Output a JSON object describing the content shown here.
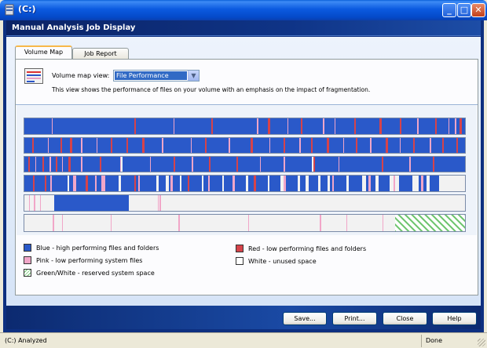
{
  "window": {
    "title": "(C:)"
  },
  "header": {
    "title": "Manual Analysis Job Display"
  },
  "tabs": [
    {
      "label": "Volume Map"
    },
    {
      "label": "Job Report"
    }
  ],
  "volume_map": {
    "view_label": "Volume map view:",
    "selected_view": "File Performance",
    "description": "This view shows the performance of files on your volume with an emphasis on the impact of fragmentation."
  },
  "legend": [
    {
      "label": "Blue - high performing files and folders"
    },
    {
      "label": "Red - low performing files and folders"
    },
    {
      "label": "Pink - low performing system files"
    },
    {
      "label": "White - unused space"
    },
    {
      "label": "Green/White - reserved system space"
    }
  ],
  "buttons": {
    "save": "Save...",
    "print": "Print...",
    "close": "Close",
    "help": "Help"
  },
  "statusbar": {
    "left": "(C:) Analyzed",
    "right": "Done"
  },
  "colors": {
    "blue": "#2a59c9",
    "red": "#d6434a",
    "pink": "#f1a6c8",
    "white": "#f2f2f2",
    "reserved_green": "#6cc46c",
    "accent_banner": "#0f3487"
  },
  "window_controls": {
    "minimize": "_",
    "maximize": "□",
    "close": "✕"
  }
}
